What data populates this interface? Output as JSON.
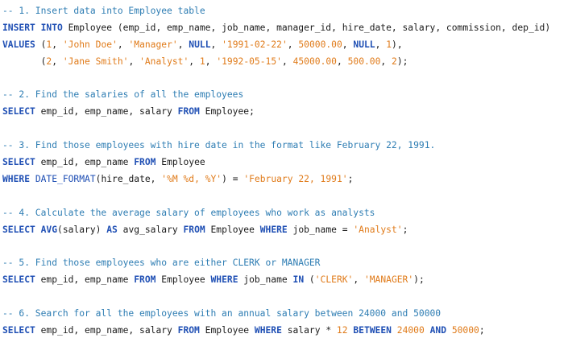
{
  "colors": {
    "background": "#ffffff",
    "comment": "#2e7db3",
    "keyword": "#1f4fb4",
    "string": "#e07b1a",
    "number": "#e07b1a",
    "function": "#1f4fb4",
    "plain": "#1a1a1a"
  },
  "lines": [
    [
      {
        "t": "comment",
        "v": "-- 1. Insert data into Employee table"
      }
    ],
    [
      {
        "t": "keyword",
        "v": "INSERT INTO"
      },
      {
        "t": "plain",
        "v": " Employee (emp_id, emp_name, job_name, manager_id, hire_date, salary, commission, dep_id)"
      }
    ],
    [
      {
        "t": "keyword",
        "v": "VALUES"
      },
      {
        "t": "plain",
        "v": " ("
      },
      {
        "t": "number",
        "v": "1"
      },
      {
        "t": "plain",
        "v": ", "
      },
      {
        "t": "string",
        "v": "'John Doe'"
      },
      {
        "t": "plain",
        "v": ", "
      },
      {
        "t": "string",
        "v": "'Manager'"
      },
      {
        "t": "plain",
        "v": ", "
      },
      {
        "t": "keyword",
        "v": "NULL"
      },
      {
        "t": "plain",
        "v": ", "
      },
      {
        "t": "string",
        "v": "'1991-02-22'"
      },
      {
        "t": "plain",
        "v": ", "
      },
      {
        "t": "number",
        "v": "50000.00"
      },
      {
        "t": "plain",
        "v": ", "
      },
      {
        "t": "keyword",
        "v": "NULL"
      },
      {
        "t": "plain",
        "v": ", "
      },
      {
        "t": "number",
        "v": "1"
      },
      {
        "t": "plain",
        "v": "),"
      }
    ],
    [
      {
        "t": "plain",
        "v": "       ("
      },
      {
        "t": "number",
        "v": "2"
      },
      {
        "t": "plain",
        "v": ", "
      },
      {
        "t": "string",
        "v": "'Jane Smith'"
      },
      {
        "t": "plain",
        "v": ", "
      },
      {
        "t": "string",
        "v": "'Analyst'"
      },
      {
        "t": "plain",
        "v": ", "
      },
      {
        "t": "number",
        "v": "1"
      },
      {
        "t": "plain",
        "v": ", "
      },
      {
        "t": "string",
        "v": "'1992-05-15'"
      },
      {
        "t": "plain",
        "v": ", "
      },
      {
        "t": "number",
        "v": "45000.00"
      },
      {
        "t": "plain",
        "v": ", "
      },
      {
        "t": "number",
        "v": "500.00"
      },
      {
        "t": "plain",
        "v": ", "
      },
      {
        "t": "number",
        "v": "2"
      },
      {
        "t": "plain",
        "v": ");"
      }
    ],
    [],
    [
      {
        "t": "comment",
        "v": "-- 2. Find the salaries of all the employees"
      }
    ],
    [
      {
        "t": "keyword",
        "v": "SELECT"
      },
      {
        "t": "plain",
        "v": " emp_id, emp_name, salary "
      },
      {
        "t": "keyword",
        "v": "FROM"
      },
      {
        "t": "plain",
        "v": " Employee;"
      }
    ],
    [],
    [
      {
        "t": "comment",
        "v": "-- 3. Find those employees with hire date in the format like February 22, 1991."
      }
    ],
    [
      {
        "t": "keyword",
        "v": "SELECT"
      },
      {
        "t": "plain",
        "v": " emp_id, emp_name "
      },
      {
        "t": "keyword",
        "v": "FROM"
      },
      {
        "t": "plain",
        "v": " Employee"
      }
    ],
    [
      {
        "t": "keyword",
        "v": "WHERE"
      },
      {
        "t": "plain",
        "v": " "
      },
      {
        "t": "function",
        "v": "DATE_FORMAT"
      },
      {
        "t": "plain",
        "v": "(hire_date, "
      },
      {
        "t": "string",
        "v": "'%M %d, %Y'"
      },
      {
        "t": "plain",
        "v": ") = "
      },
      {
        "t": "string",
        "v": "'February 22, 1991'"
      },
      {
        "t": "plain",
        "v": ";"
      }
    ],
    [],
    [
      {
        "t": "comment",
        "v": "-- 4. Calculate the average salary of employees who work as analysts"
      }
    ],
    [
      {
        "t": "keyword",
        "v": "SELECT"
      },
      {
        "t": "plain",
        "v": " "
      },
      {
        "t": "keyword",
        "v": "AVG"
      },
      {
        "t": "plain",
        "v": "(salary) "
      },
      {
        "t": "keyword",
        "v": "AS"
      },
      {
        "t": "plain",
        "v": " avg_salary "
      },
      {
        "t": "keyword",
        "v": "FROM"
      },
      {
        "t": "plain",
        "v": " Employee "
      },
      {
        "t": "keyword",
        "v": "WHERE"
      },
      {
        "t": "plain",
        "v": " job_name = "
      },
      {
        "t": "string",
        "v": "'Analyst'"
      },
      {
        "t": "plain",
        "v": ";"
      }
    ],
    [],
    [
      {
        "t": "comment",
        "v": "-- 5. Find those employees who are either CLERK or MANAGER"
      }
    ],
    [
      {
        "t": "keyword",
        "v": "SELECT"
      },
      {
        "t": "plain",
        "v": " emp_id, emp_name "
      },
      {
        "t": "keyword",
        "v": "FROM"
      },
      {
        "t": "plain",
        "v": " Employee "
      },
      {
        "t": "keyword",
        "v": "WHERE"
      },
      {
        "t": "plain",
        "v": " job_name "
      },
      {
        "t": "keyword",
        "v": "IN"
      },
      {
        "t": "plain",
        "v": " ("
      },
      {
        "t": "string",
        "v": "'CLERK'"
      },
      {
        "t": "plain",
        "v": ", "
      },
      {
        "t": "string",
        "v": "'MANAGER'"
      },
      {
        "t": "plain",
        "v": ");"
      }
    ],
    [],
    [
      {
        "t": "comment",
        "v": "-- 6. Search for all the employees with an annual salary between 24000 and 50000"
      }
    ],
    [
      {
        "t": "keyword",
        "v": "SELECT"
      },
      {
        "t": "plain",
        "v": " emp_id, emp_name, salary "
      },
      {
        "t": "keyword",
        "v": "FROM"
      },
      {
        "t": "plain",
        "v": " Employee "
      },
      {
        "t": "keyword",
        "v": "WHERE"
      },
      {
        "t": "plain",
        "v": " salary * "
      },
      {
        "t": "number",
        "v": "12"
      },
      {
        "t": "plain",
        "v": " "
      },
      {
        "t": "keyword",
        "v": "BETWEEN"
      },
      {
        "t": "plain",
        "v": " "
      },
      {
        "t": "number",
        "v": "24000"
      },
      {
        "t": "plain",
        "v": " "
      },
      {
        "t": "keyword",
        "v": "AND"
      },
      {
        "t": "plain",
        "v": " "
      },
      {
        "t": "number",
        "v": "50000"
      },
      {
        "t": "plain",
        "v": ";"
      }
    ]
  ]
}
